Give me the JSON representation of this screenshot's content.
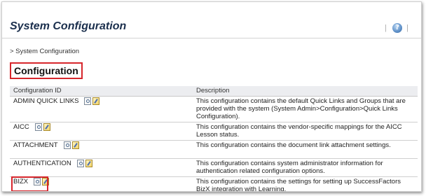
{
  "header": {
    "title": "System Configuration",
    "separator": "|",
    "help_icon": "help-icon",
    "help_glyph": "?"
  },
  "breadcrumb": "> System Configuration",
  "section": {
    "title": "Configuration"
  },
  "table": {
    "columns": [
      "Configuration ID",
      "Description"
    ],
    "rows": [
      {
        "id": "ADMIN QUICK LINKS",
        "description": "This configuration contains the default Quick Links and Groups that are provided with the system (System Admin>Configuration>Quick Links Configuration).",
        "icons": [
          "view-icon",
          "edit-icon"
        ]
      },
      {
        "id": "AICC",
        "description": "This configuration contains the vendor-specific mappings for the AICC Lesson status.",
        "icons": [
          "view-icon",
          "edit-icon"
        ]
      },
      {
        "id": "ATTACHMENT",
        "description": "This configuration contains the document link attachment settings.",
        "icons": [
          "view-icon",
          "edit-icon"
        ]
      },
      {
        "id": "AUTHENTICATION",
        "description": "This configuration contains system administrator information for authentication related configuration options.",
        "icons": [
          "view-icon",
          "edit-icon"
        ]
      },
      {
        "id": "BIZX",
        "description": "This configuration contains the settings for setting up SuccessFactors BizX integration with Learning.",
        "icons": [
          "view-icon",
          "edit-icon"
        ]
      }
    ]
  },
  "colors": {
    "highlight": "#d6262c",
    "title": "#1b2f4d",
    "header_bg": "#ecedf0"
  }
}
